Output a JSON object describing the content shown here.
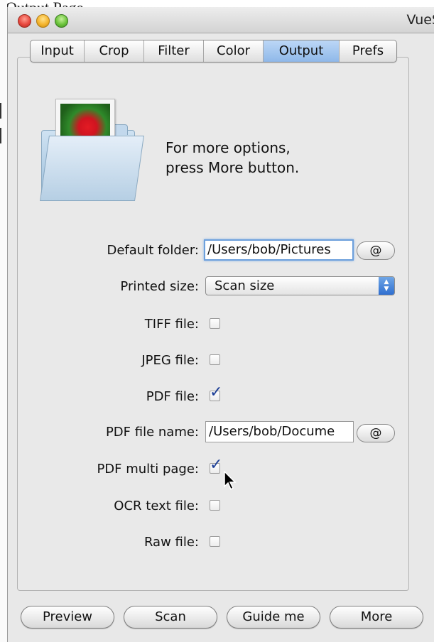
{
  "window": {
    "title": "VueS"
  },
  "background": {
    "top_caption": "Output Page"
  },
  "tabs": [
    {
      "label": "Input"
    },
    {
      "label": "Crop"
    },
    {
      "label": "Filter"
    },
    {
      "label": "Color"
    },
    {
      "label": "Output",
      "active": true
    },
    {
      "label": "Prefs"
    }
  ],
  "hint": {
    "line1": "For more options,",
    "line2": "press More button."
  },
  "form": {
    "default_folder": {
      "label": "Default folder:",
      "value": "/Users/bob/Pictures",
      "button": "@"
    },
    "printed_size": {
      "label": "Printed size:",
      "value": "Scan size"
    },
    "tiff_file": {
      "label": "TIFF file:",
      "checked": false
    },
    "jpeg_file": {
      "label": "JPEG file:",
      "checked": false
    },
    "pdf_file": {
      "label": "PDF file:",
      "checked": true
    },
    "pdf_file_name": {
      "label": "PDF file name:",
      "value": "/Users/bob/Docume",
      "button": "@"
    },
    "pdf_multi_page": {
      "label": "PDF multi page:",
      "checked": true
    },
    "ocr_text_file": {
      "label": "OCR text file:",
      "checked": false
    },
    "raw_file": {
      "label": "Raw file:",
      "checked": false
    }
  },
  "buttons": {
    "preview": "Preview",
    "scan": "Scan",
    "guide_me": "Guide me",
    "more": "More"
  },
  "colors": {
    "accent": "#8fb8e9",
    "checkmark": "#1d3f96"
  }
}
